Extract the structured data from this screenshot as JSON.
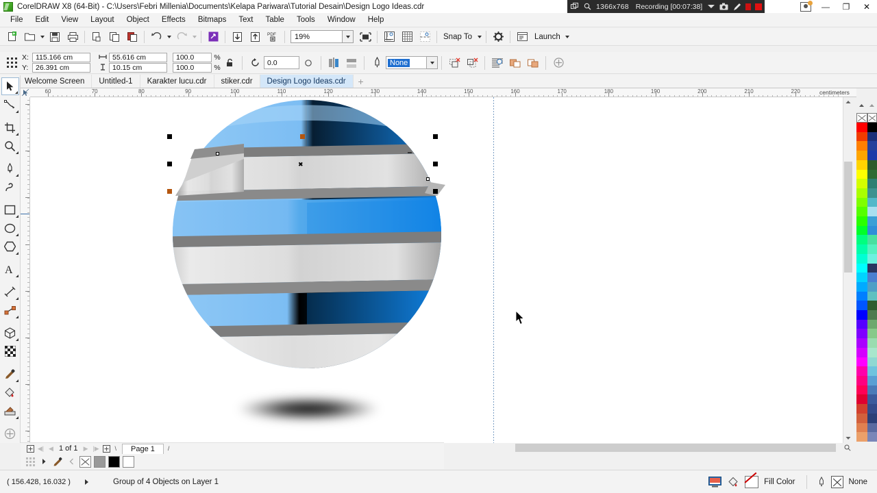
{
  "window": {
    "title": "CorelDRAW X8 (64-Bit) - C:\\Users\\Febri Millenia\\Documents\\Kelapa Pariwara\\Tutorial Desain\\Design Logo Ideas.cdr",
    "app_icon": "coreldraw-logo-icon",
    "minimize_label": "—",
    "restore_label": "❐",
    "close_label": "✕"
  },
  "recorder": {
    "window_icon": "window-select-icon",
    "magnifier_icon": "magnifier-icon",
    "resolution": "1366x768",
    "status": "Recording [00:07:38]",
    "dropdown_icon": "chevron-down-icon",
    "camera_icon": "camera-icon",
    "pencil_icon": "pencil-icon",
    "pause_icon": "pause-icon",
    "stop_icon": "stop-icon"
  },
  "menubar": {
    "items": [
      {
        "label": "File"
      },
      {
        "label": "Edit"
      },
      {
        "label": "View"
      },
      {
        "label": "Layout"
      },
      {
        "label": "Object"
      },
      {
        "label": "Effects"
      },
      {
        "label": "Bitmaps"
      },
      {
        "label": "Text"
      },
      {
        "label": "Table"
      },
      {
        "label": "Tools"
      },
      {
        "label": "Window"
      },
      {
        "label": "Help"
      }
    ]
  },
  "toolbar": {
    "new_icon": "new-document-icon",
    "open_icon": "open-folder-icon",
    "save_icon": "save-floppy-icon",
    "print_icon": "print-icon",
    "cut_icon": "cut-icon",
    "copy_icon": "copy-icon",
    "paste_icon": "paste-icon",
    "undo_icon": "undo-arrow-icon",
    "redo_icon": "redo-arrow-icon",
    "search_content_icon": "search-content-icon",
    "import_icon": "import-down-icon",
    "export_icon": "export-up-icon",
    "publish_pdf_icon": "pdf-icon",
    "zoom_level": "19%",
    "zoom_dropdown_icon": "chevron-down-icon",
    "fullscreen_icon": "full-screen-preview-icon",
    "show_rulers_icon": "rulers-icon",
    "show_grid_icon": "grid-icon",
    "show_guides_icon": "guidelines-icon",
    "snap_to_label": "Snap To",
    "options_icon": "gear-icon",
    "launch_label": "Launch",
    "launch_icon": "launch-app-icon"
  },
  "propertybar": {
    "object_origin_icon": "object-origin-icon",
    "x_label": "X:",
    "x_value": "115.166 cm",
    "y_label": "Y:",
    "y_value": "26.391 cm",
    "width_icon": "width-icon",
    "width_value": "55.616 cm",
    "height_icon": "height-icon",
    "height_value": "10.15 cm",
    "scale_h": "100.0",
    "scale_v": "100.0",
    "percent": "%",
    "lock_ratio_icon": "lock-ratio-icon",
    "rotate_icon": "rotate-icon",
    "rotation_value": "0.0",
    "degree_icon": "degrees-icon",
    "mirror_h_icon": "mirror-horizontal-icon",
    "mirror_v_icon": "mirror-vertical-icon",
    "outline_pen_icon": "outline-pen-icon",
    "outline_width": "None",
    "outline_dropdown_icon": "chevron-down-icon",
    "to_front_icon": "to-front-icon",
    "to_back_icon": "to-back-icon",
    "wrap_text_icon": "wrap-paragraph-text-icon",
    "weld_icon": "weld-icon",
    "trim_icon": "trim-icon",
    "edit_icon": "add-node-icon"
  },
  "doctabs": {
    "home_icon": "home-icon",
    "add_icon": "plus-icon",
    "tabs": [
      {
        "label": "Welcome Screen",
        "active": false
      },
      {
        "label": "Untitled-1",
        "active": false
      },
      {
        "label": "Karakter lucu.cdr",
        "active": false
      },
      {
        "label": "stiker.cdr",
        "active": false
      },
      {
        "label": "Design Logo Ideas.cdr",
        "active": true
      }
    ]
  },
  "toolbox": {
    "tools": [
      {
        "name": "pick-tool",
        "icon": "arrow-cursor-icon",
        "selected": true
      },
      {
        "name": "shape-tool",
        "icon": "node-edit-icon",
        "selected": false
      },
      {
        "name": "crop-tool",
        "icon": "crop-icon",
        "selected": false
      },
      {
        "name": "zoom-tool",
        "icon": "magnifier-icon",
        "selected": false
      },
      {
        "name": "freehand-tool",
        "icon": "pen-nib-icon",
        "selected": false
      },
      {
        "name": "artistic-media-tool",
        "icon": "artistic-media-icon",
        "selected": false
      },
      {
        "name": "rectangle-tool",
        "icon": "rectangle-icon",
        "selected": false
      },
      {
        "name": "ellipse-tool",
        "icon": "ellipse-icon",
        "selected": false
      },
      {
        "name": "polygon-tool",
        "icon": "polygon-icon",
        "selected": false
      },
      {
        "name": "text-tool",
        "icon": "letter-a-icon",
        "selected": false
      },
      {
        "name": "parallel-dimension-tool",
        "icon": "dimension-line-icon",
        "selected": false
      },
      {
        "name": "straight-line-connector-tool",
        "icon": "connector-icon",
        "selected": false
      },
      {
        "name": "drop-shadow-tool",
        "icon": "extrude-cube-icon",
        "selected": false
      },
      {
        "name": "transparency-tool",
        "icon": "checkerboard-icon",
        "selected": false
      },
      {
        "name": "color-eyedropper-tool",
        "icon": "eyedropper-icon",
        "selected": false
      },
      {
        "name": "interactive-fill-tool",
        "icon": "paint-bucket-icon",
        "selected": false
      },
      {
        "name": "smart-fill-tool",
        "icon": "smart-fill-icon",
        "selected": false
      },
      {
        "name": "quick-customize",
        "icon": "plus-circle-icon",
        "selected": false
      }
    ]
  },
  "rulers": {
    "units": "centimeters",
    "h_labels": [
      "60",
      "70",
      "80",
      "90",
      "100",
      "110",
      "120",
      "130",
      "140",
      "150",
      "160",
      "170",
      "180",
      "190",
      "200",
      "210",
      "220"
    ],
    "v_origin_icon": "ruler-origin-icon"
  },
  "canvas": {
    "artwork_name": "striped-globe-logo",
    "colors": {
      "blue_light": "#6fb7f2",
      "blue_mid": "#4a9fe8",
      "blue_dark": "#1f86e0",
      "gray_light": "#e4e4e4",
      "gray_mid": "#c9c9c9",
      "gray_dark": "#8a8a8a",
      "band_edge": "#7d7d7d"
    },
    "cursor_icon": "arrow-cursor-icon",
    "selection": {
      "handle_color": "#000000",
      "rotation_handle_color": "#b4560f"
    }
  },
  "pagenav": {
    "first_icon": "first-page-icon",
    "prev_icon": "previous-page-icon",
    "next_icon": "next-page-icon",
    "last_icon": "last-page-icon",
    "add_left_icon": "add-page-before-icon",
    "add_right_icon": "add-page-after-icon",
    "page_text": "1 of 1",
    "page_tab": "Page 1"
  },
  "bottomstrip": {
    "grid_icon": "document-palette-icon",
    "expand_icon": "expand-arrow-icon",
    "eyedropper_icon": "eyedropper-icon",
    "scroll_left_icon": "scroll-left-icon",
    "swatches": [
      "none",
      "#999999",
      "#000000",
      "#ffffff"
    ]
  },
  "statusbar": {
    "coordinates": "( 156.428, 16.032 )",
    "expand_icon": "expand-arrow-icon",
    "object_info": "Group of 4 Objects on Layer 1",
    "palette_icon": "color-palette-icon",
    "fill_icon": "fill-bucket-icon",
    "fill_label": "Fill Color",
    "outline_icon": "outline-pen-icon",
    "outline_label": "None"
  },
  "palette": {
    "top_swatch": "none",
    "colors_col1": [
      "#ff0000",
      "#f03c00",
      "#ff7f00",
      "#ffa500",
      "#ffd400",
      "#ffff00",
      "#d4ff00",
      "#aaff00",
      "#7fff00",
      "#55ff00",
      "#2aff00",
      "#00ff2a",
      "#00ff7f",
      "#00ffaa",
      "#00ffd4",
      "#00ffff",
      "#00d4ff",
      "#00aaff",
      "#007fff",
      "#0055ff",
      "#0000ff",
      "#5500ff",
      "#7f00ff",
      "#aa00ff",
      "#d400ff",
      "#ff00ff",
      "#ff00aa",
      "#ff0080",
      "#ff0055",
      "#e00030",
      "#d2402e",
      "#d2603c",
      "#e08050",
      "#eba06a"
    ],
    "colors_col2": [
      "#000000",
      "#1b2f7a",
      "#24409c",
      "#1d3aa8",
      "#2b5a2b",
      "#2f6b34",
      "#2e7f72",
      "#3d9290",
      "#52b8c9",
      "#a8dff0",
      "#3b9fd6",
      "#2f8fd8",
      "#49e0a0",
      "#56f0c0",
      "#6ef0e0",
      "#2a3560",
      "#4a7fd0",
      "#4e9fc6",
      "#5ec0c0",
      "#2f5c2f",
      "#4e7a4e",
      "#6ea86e",
      "#88c98a",
      "#9adcb0",
      "#a8e6cc",
      "#8fd8d2",
      "#6fc3de",
      "#5a9fd4",
      "#4a7ab8",
      "#3b5a9c",
      "#334a8a",
      "#2b3f77",
      "#5a6aa0",
      "#7a86b8"
    ]
  }
}
